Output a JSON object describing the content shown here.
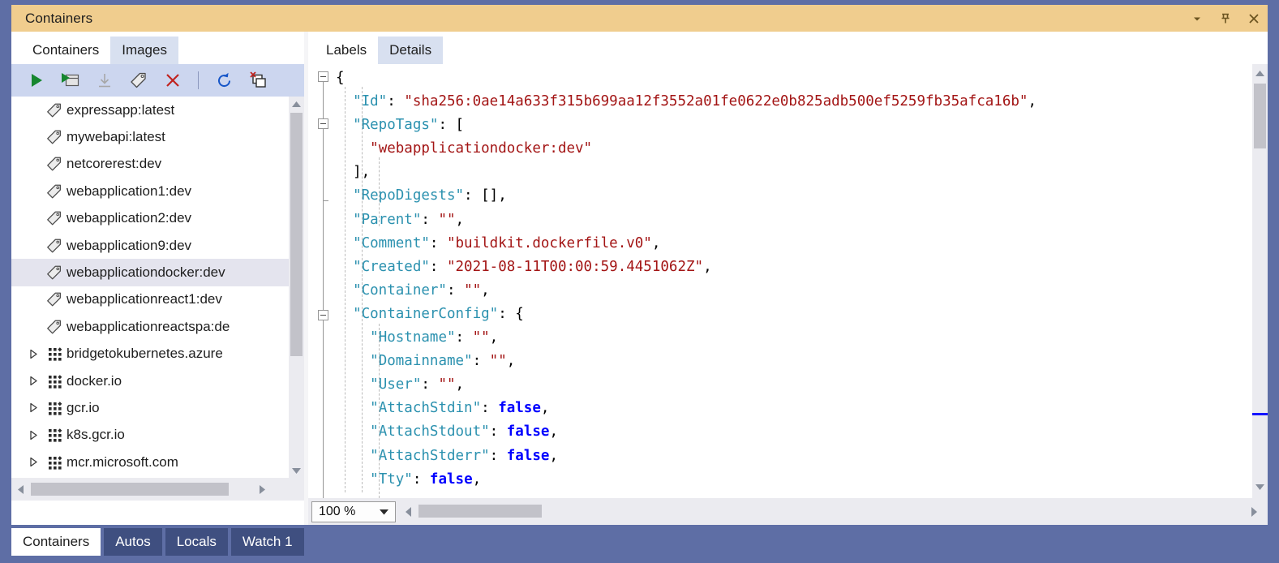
{
  "window": {
    "title": "Containers",
    "controls": [
      {
        "name": "dropdown-caret",
        "icon": "chevron-down-icon"
      },
      {
        "name": "pin",
        "icon": "pin-icon"
      },
      {
        "name": "close",
        "icon": "close-icon"
      }
    ]
  },
  "left_panel": {
    "tabs": [
      {
        "label": "Containers",
        "active": false
      },
      {
        "label": "Images",
        "active": true
      }
    ],
    "toolbar": [
      {
        "name": "run-button",
        "icon": "play-icon",
        "tooltip": "Run"
      },
      {
        "name": "open-in-browser-button",
        "icon": "run-window-icon",
        "tooltip": "Open"
      },
      {
        "name": "pull-button",
        "icon": "download-icon",
        "tooltip": "Pull",
        "disabled": true
      },
      {
        "name": "tag-button",
        "icon": "tag-icon",
        "tooltip": "Tag"
      },
      {
        "name": "remove-button",
        "icon": "x-red-icon",
        "tooltip": "Remove"
      },
      {
        "name": "refresh-button",
        "icon": "refresh-icon",
        "tooltip": "Refresh"
      },
      {
        "name": "prune-button",
        "icon": "prune-images-icon",
        "tooltip": "Prune"
      }
    ],
    "items": [
      {
        "label": "expressapp:latest",
        "icon": "tag-icon",
        "type": "image",
        "selected": false,
        "expandable": false
      },
      {
        "label": "mywebapi:latest",
        "icon": "tag-icon",
        "type": "image",
        "selected": false,
        "expandable": false
      },
      {
        "label": "netcorerest:dev",
        "icon": "tag-icon",
        "type": "image",
        "selected": false,
        "expandable": false
      },
      {
        "label": "webapplication1:dev",
        "icon": "tag-icon",
        "type": "image",
        "selected": false,
        "expandable": false
      },
      {
        "label": "webapplication2:dev",
        "icon": "tag-icon",
        "type": "image",
        "selected": false,
        "expandable": false
      },
      {
        "label": "webapplication9:dev",
        "icon": "tag-icon",
        "type": "image",
        "selected": false,
        "expandable": false
      },
      {
        "label": "webapplicationdocker:dev",
        "icon": "tag-icon",
        "type": "image",
        "selected": true,
        "expandable": false
      },
      {
        "label": "webapplicationreact1:dev",
        "icon": "tag-icon",
        "type": "image",
        "selected": false,
        "expandable": false
      },
      {
        "label": "webapplicationreactspa:de",
        "icon": "tag-icon",
        "type": "image",
        "selected": false,
        "expandable": false
      },
      {
        "label": "bridgetokubernetes.azure",
        "icon": "registry-icon",
        "type": "registry",
        "selected": false,
        "expandable": true
      },
      {
        "label": "docker.io",
        "icon": "registry-icon",
        "type": "registry",
        "selected": false,
        "expandable": true
      },
      {
        "label": "gcr.io",
        "icon": "registry-icon",
        "type": "registry",
        "selected": false,
        "expandable": true
      },
      {
        "label": "k8s.gcr.io",
        "icon": "registry-icon",
        "type": "registry",
        "selected": false,
        "expandable": true
      },
      {
        "label": "mcr.microsoft.com",
        "icon": "registry-icon",
        "type": "registry",
        "selected": false,
        "expandable": true
      }
    ]
  },
  "right_panel": {
    "tabs": [
      {
        "label": "Labels",
        "active": false
      },
      {
        "label": "Details",
        "active": true
      }
    ],
    "zoom": "100 %",
    "code_lines": [
      [
        {
          "t": "{",
          "c": "p"
        }
      ],
      [
        {
          "t": "  ",
          "c": "p"
        },
        {
          "t": "\"Id\"",
          "c": "k"
        },
        {
          "t": ": ",
          "c": "p"
        },
        {
          "t": "\"sha256:0ae14a633f315b699aa12f3552a01fe0622e0b825adb500ef5259fb35afca16b\"",
          "c": "s"
        },
        {
          "t": ",",
          "c": "p"
        }
      ],
      [
        {
          "t": "  ",
          "c": "p"
        },
        {
          "t": "\"RepoTags\"",
          "c": "k"
        },
        {
          "t": ": [",
          "c": "p"
        }
      ],
      [
        {
          "t": "    ",
          "c": "p"
        },
        {
          "t": "\"webapplicationdocker:dev\"",
          "c": "s"
        }
      ],
      [
        {
          "t": "  ],",
          "c": "p"
        }
      ],
      [
        {
          "t": "  ",
          "c": "p"
        },
        {
          "t": "\"RepoDigests\"",
          "c": "k"
        },
        {
          "t": ": [],",
          "c": "p"
        }
      ],
      [
        {
          "t": "  ",
          "c": "p"
        },
        {
          "t": "\"Parent\"",
          "c": "k"
        },
        {
          "t": ": ",
          "c": "p"
        },
        {
          "t": "\"\"",
          "c": "s"
        },
        {
          "t": ",",
          "c": "p"
        }
      ],
      [
        {
          "t": "  ",
          "c": "p"
        },
        {
          "t": "\"Comment\"",
          "c": "k"
        },
        {
          "t": ": ",
          "c": "p"
        },
        {
          "t": "\"buildkit.dockerfile.v0\"",
          "c": "s"
        },
        {
          "t": ",",
          "c": "p"
        }
      ],
      [
        {
          "t": "  ",
          "c": "p"
        },
        {
          "t": "\"Created\"",
          "c": "k"
        },
        {
          "t": ": ",
          "c": "p"
        },
        {
          "t": "\"2021-08-11T00:00:59.4451062Z\"",
          "c": "s"
        },
        {
          "t": ",",
          "c": "p"
        }
      ],
      [
        {
          "t": "  ",
          "c": "p"
        },
        {
          "t": "\"Container\"",
          "c": "k"
        },
        {
          "t": ": ",
          "c": "p"
        },
        {
          "t": "\"\"",
          "c": "s"
        },
        {
          "t": ",",
          "c": "p"
        }
      ],
      [
        {
          "t": "  ",
          "c": "p"
        },
        {
          "t": "\"ContainerConfig\"",
          "c": "k"
        },
        {
          "t": ": {",
          "c": "p"
        }
      ],
      [
        {
          "t": "    ",
          "c": "p"
        },
        {
          "t": "\"Hostname\"",
          "c": "k"
        },
        {
          "t": ": ",
          "c": "p"
        },
        {
          "t": "\"\"",
          "c": "s"
        },
        {
          "t": ",",
          "c": "p"
        }
      ],
      [
        {
          "t": "    ",
          "c": "p"
        },
        {
          "t": "\"Domainname\"",
          "c": "k"
        },
        {
          "t": ": ",
          "c": "p"
        },
        {
          "t": "\"\"",
          "c": "s"
        },
        {
          "t": ",",
          "c": "p"
        }
      ],
      [
        {
          "t": "    ",
          "c": "p"
        },
        {
          "t": "\"User\"",
          "c": "k"
        },
        {
          "t": ": ",
          "c": "p"
        },
        {
          "t": "\"\"",
          "c": "s"
        },
        {
          "t": ",",
          "c": "p"
        }
      ],
      [
        {
          "t": "    ",
          "c": "p"
        },
        {
          "t": "\"AttachStdin\"",
          "c": "k"
        },
        {
          "t": ": ",
          "c": "p"
        },
        {
          "t": "false",
          "c": "b"
        },
        {
          "t": ",",
          "c": "p"
        }
      ],
      [
        {
          "t": "    ",
          "c": "p"
        },
        {
          "t": "\"AttachStdout\"",
          "c": "k"
        },
        {
          "t": ": ",
          "c": "p"
        },
        {
          "t": "false",
          "c": "b"
        },
        {
          "t": ",",
          "c": "p"
        }
      ],
      [
        {
          "t": "    ",
          "c": "p"
        },
        {
          "t": "\"AttachStderr\"",
          "c": "k"
        },
        {
          "t": ": ",
          "c": "p"
        },
        {
          "t": "false",
          "c": "b"
        },
        {
          "t": ",",
          "c": "p"
        }
      ],
      [
        {
          "t": "    ",
          "c": "p"
        },
        {
          "t": "\"Tty\"",
          "c": "k"
        },
        {
          "t": ": ",
          "c": "p"
        },
        {
          "t": "false",
          "c": "b"
        },
        {
          "t": ",",
          "c": "p"
        }
      ]
    ]
  },
  "bottom_tabs": [
    {
      "label": "Containers",
      "active": true
    },
    {
      "label": "Autos",
      "active": false
    },
    {
      "label": "Locals",
      "active": false
    },
    {
      "label": "Watch 1",
      "active": false
    }
  ],
  "colors": {
    "titlebar": "#f0cd8e",
    "accent_chrome": "#5e6ea5",
    "toolbar": "#ccd6ef",
    "tab_active": "#d8e0f0",
    "selection": "#e4e4ee",
    "json_key": "#2b91af",
    "json_string": "#a31515",
    "json_bool": "#0000ff",
    "scroll_marker": "#1414ff"
  }
}
